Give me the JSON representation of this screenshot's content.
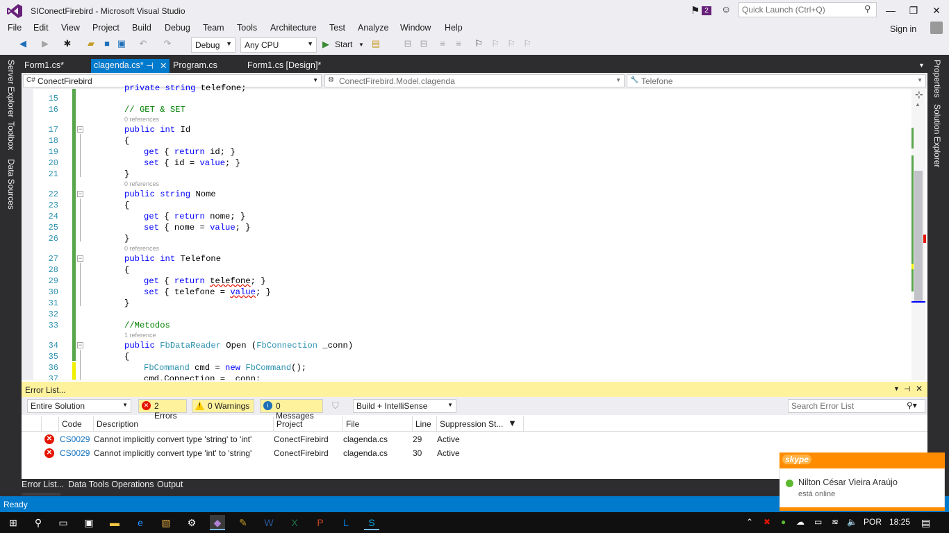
{
  "window": {
    "title": "SIConectFirebird - Microsoft Visual Studio",
    "notification_count": "2",
    "quick_launch_placeholder": "Quick Launch (Ctrl+Q)",
    "sign_in": "Sign in",
    "controls": {
      "minimize": "—",
      "restore": "❐",
      "close": "✕"
    }
  },
  "menu": [
    "File",
    "Edit",
    "View",
    "Project",
    "Build",
    "Debug",
    "Team",
    "Tools",
    "Architecture",
    "Test",
    "Analyze",
    "Window",
    "Help"
  ],
  "toolbar": {
    "config": "Debug",
    "platform": "Any CPU",
    "start": "Start"
  },
  "left_dock": [
    "Server Explorer",
    "Toolbox",
    "Data Sources"
  ],
  "right_dock": [
    "Properties",
    "Solution Explorer"
  ],
  "doc_tabs": [
    {
      "label": "Form1.cs*",
      "active": false
    },
    {
      "label": "clagenda.cs*",
      "active": true
    },
    {
      "label": "Program.cs",
      "active": false
    },
    {
      "label": "Form1.cs [Design]*",
      "active": false
    }
  ],
  "nav": {
    "project": "ConectFirebird",
    "type": "ConectFirebird.Model.clagenda",
    "member": "Telefone"
  },
  "code": {
    "partial_line": "private string telefone;",
    "lines": [
      {
        "n": "15",
        "text": ""
      },
      {
        "n": "16",
        "text": "// GET & SET"
      },
      {
        "n": "17",
        "text": "public int Id"
      },
      {
        "n": "18",
        "text": "{"
      },
      {
        "n": "19",
        "text": "get { return id; }"
      },
      {
        "n": "20",
        "text": "set { id = value; }"
      },
      {
        "n": "21",
        "text": "}"
      },
      {
        "n": "22",
        "text": "public string Nome"
      },
      {
        "n": "23",
        "text": "{"
      },
      {
        "n": "24",
        "text": "get { return nome; }"
      },
      {
        "n": "25",
        "text": "set { nome = value; }"
      },
      {
        "n": "26",
        "text": "}"
      },
      {
        "n": "27",
        "text": "public int Telefone"
      },
      {
        "n": "28",
        "text": "{"
      },
      {
        "n": "29",
        "text": "get { return telefone; }"
      },
      {
        "n": "30",
        "text": "set { telefone = value; }"
      },
      {
        "n": "31",
        "text": "}"
      },
      {
        "n": "32",
        "text": ""
      },
      {
        "n": "33",
        "text": "//Metodos"
      },
      {
        "n": "34",
        "text": "public FbDataReader Open (FbConnection _conn)"
      },
      {
        "n": "35",
        "text": "{"
      },
      {
        "n": "36",
        "text": "FbCommand cmd = new FbCommand();"
      },
      {
        "n": "37",
        "text": "cmd.Connection = _conn;"
      }
    ],
    "refs": [
      "0 references",
      "0 references",
      "0 references",
      "1 reference"
    ],
    "tokens": {
      "kw_public": "public",
      "kw_int": "int",
      "kw_string": "string",
      "kw_get": "get",
      "kw_set": "set",
      "kw_return": "return",
      "kw_value": "value",
      "kw_new": "new",
      "comment_getset": "// GET & SET",
      "comment_metodos": "//Metodos",
      "id": "Id",
      "nome": "Nome",
      "telefone_prop": "Telefone",
      "fbdatareader": "FbDataReader",
      "fbconnection": "FbConnection",
      "fbcommand": "FbCommand"
    }
  },
  "error_list": {
    "title": "Error List...",
    "scope": "Entire Solution",
    "errors_btn": "2 Errors",
    "warnings_btn": "0 Warnings",
    "messages_btn": "0 Messages",
    "build_filter": "Build + IntelliSense",
    "search_placeholder": "Search Error List",
    "columns": [
      "Code",
      "Description",
      "Project",
      "File",
      "Line",
      "Suppression St..."
    ],
    "rows": [
      {
        "code": "CS0029",
        "description": "Cannot implicitly convert type 'string' to 'int'",
        "project": "ConectFirebird",
        "file": "clagenda.cs",
        "line": "29",
        "state": "Active"
      },
      {
        "code": "CS0029",
        "description": "Cannot implicitly convert type 'int' to 'string'",
        "project": "ConectFirebird",
        "file": "clagenda.cs",
        "line": "30",
        "state": "Active"
      }
    ]
  },
  "bottom_tabs": [
    "Error List...",
    "Data Tools Operations",
    "Output"
  ],
  "status": "Ready",
  "skype_toast": {
    "brand": "skype",
    "name": "Nilton César Vieira  Araújo",
    "status": "está online"
  },
  "taskbar": {
    "language": "POR",
    "time": "18:25"
  },
  "colors": {
    "accent": "#007acc",
    "vs_purple": "#68217a",
    "error_red": "#e51400",
    "warning_bar": "#fff29d",
    "skype_orange": "#ff8c00"
  }
}
